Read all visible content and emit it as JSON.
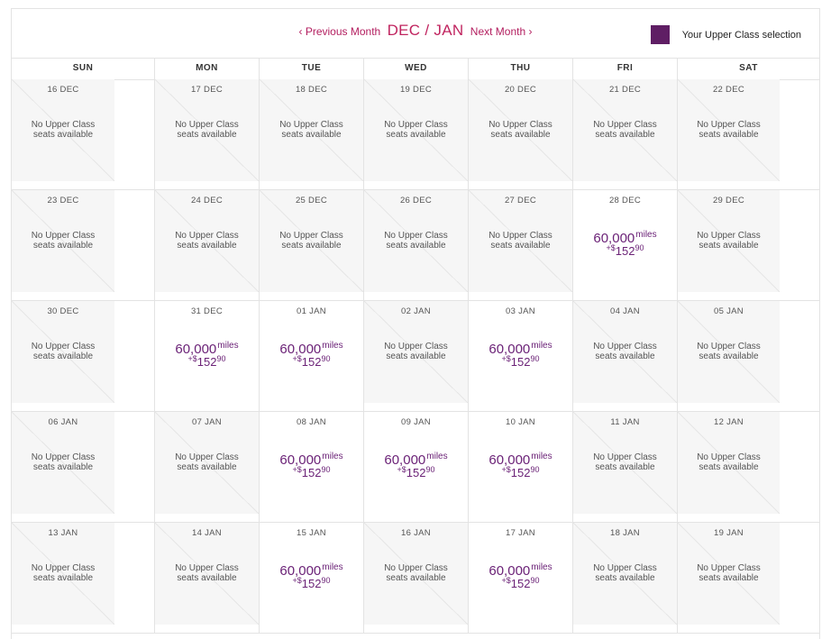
{
  "nav": {
    "prev_label": "Previous Month",
    "prev_chevron": "‹",
    "month_label": "DEC / JAN",
    "next_label": "Next Month",
    "next_chevron": "›"
  },
  "legend": {
    "label": "Your Upper Class selection",
    "swatch_color": "#5f1e64"
  },
  "weekdays": [
    "SUN",
    "MON",
    "TUE",
    "WED",
    "THU",
    "FRI",
    "SAT"
  ],
  "unavailable_line1": "No Upper Class",
  "unavailable_line2": "seats available",
  "fare": {
    "miles": "60,000",
    "miles_unit": "miles",
    "plus": "+",
    "currency": "$",
    "cash_whole": "152",
    "cash_cents": "90"
  },
  "weeks": [
    [
      {
        "date": "16 DEC",
        "available": false
      },
      {
        "date": "17 DEC",
        "available": false
      },
      {
        "date": "18 DEC",
        "available": false
      },
      {
        "date": "19 DEC",
        "available": false
      },
      {
        "date": "20 DEC",
        "available": false
      },
      {
        "date": "21 DEC",
        "available": false
      },
      {
        "date": "22 DEC",
        "available": false
      }
    ],
    [
      {
        "date": "23 DEC",
        "available": false
      },
      {
        "date": "24 DEC",
        "available": false
      },
      {
        "date": "25 DEC",
        "available": false
      },
      {
        "date": "26 DEC",
        "available": false
      },
      {
        "date": "27 DEC",
        "available": false
      },
      {
        "date": "28 DEC",
        "available": true
      },
      {
        "date": "29 DEC",
        "available": false
      }
    ],
    [
      {
        "date": "30 DEC",
        "available": false
      },
      {
        "date": "31 DEC",
        "available": true
      },
      {
        "date": "01 JAN",
        "available": true
      },
      {
        "date": "02 JAN",
        "available": false
      },
      {
        "date": "03 JAN",
        "available": true
      },
      {
        "date": "04 JAN",
        "available": false
      },
      {
        "date": "05 JAN",
        "available": false
      }
    ],
    [
      {
        "date": "06 JAN",
        "available": false
      },
      {
        "date": "07 JAN",
        "available": false
      },
      {
        "date": "08 JAN",
        "available": true
      },
      {
        "date": "09 JAN",
        "available": true
      },
      {
        "date": "10 JAN",
        "available": true
      },
      {
        "date": "11 JAN",
        "available": false
      },
      {
        "date": "12 JAN",
        "available": false
      }
    ],
    [
      {
        "date": "13 JAN",
        "available": false
      },
      {
        "date": "14 JAN",
        "available": false
      },
      {
        "date": "15 JAN",
        "available": true
      },
      {
        "date": "16 JAN",
        "available": false
      },
      {
        "date": "17 JAN",
        "available": true
      },
      {
        "date": "18 JAN",
        "available": false
      },
      {
        "date": "19 JAN",
        "available": false
      }
    ]
  ]
}
